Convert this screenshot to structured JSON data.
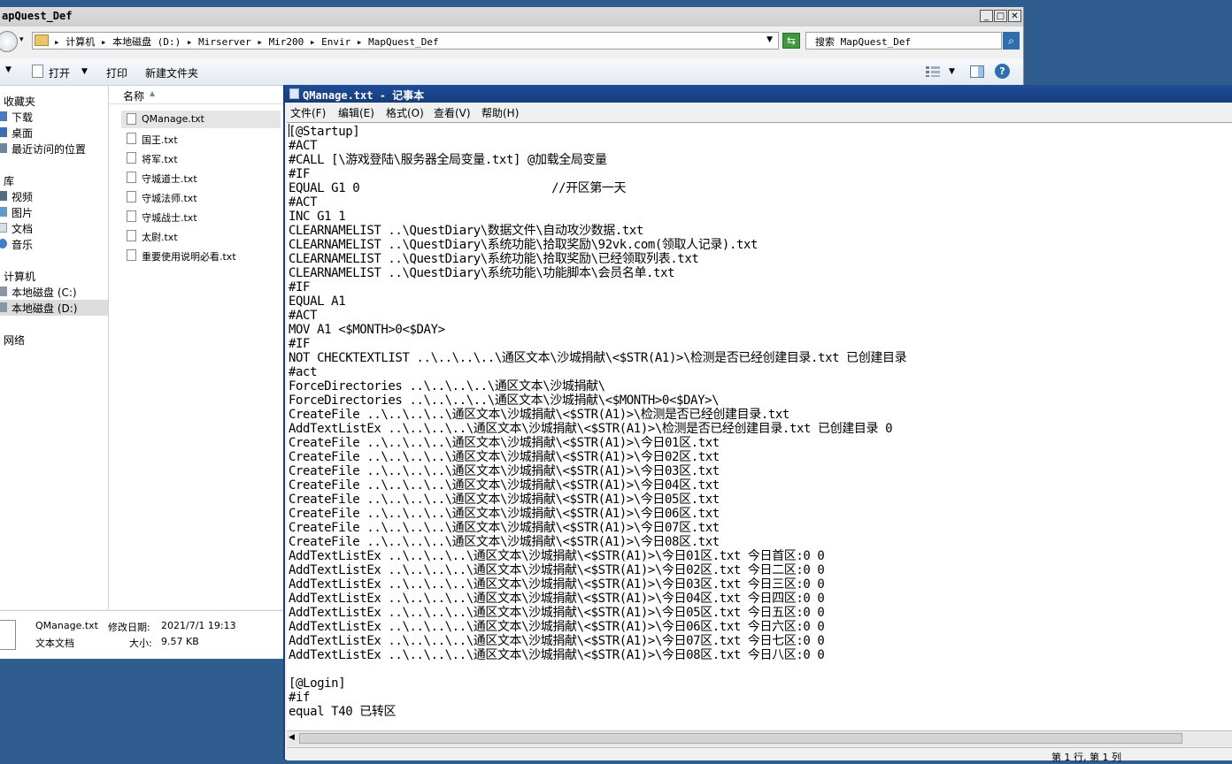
{
  "explorer": {
    "title": "apQuest_Def",
    "breadcrumbs": "▸ 计算机 ▸ 本地磁盘 (D:) ▸ Mirserver ▸ Mir200 ▸ Envir ▸ MapQuest_Def",
    "search_placeholder": "搜索 MapQuest_Def",
    "toolbar": {
      "open": "打开",
      "print": "打印",
      "new_folder": "新建文件夹"
    },
    "nav": {
      "favorites": "收藏夹",
      "downloads": "下载",
      "desktop": "桌面",
      "recent": "最近访问的位置",
      "libraries": "库",
      "videos": "视频",
      "pictures": "图片",
      "documents": "文档",
      "music": "音乐",
      "computer": "计算机",
      "drive_c": "本地磁盘 (C:)",
      "drive_d": "本地磁盘 (D:)",
      "network": "网络"
    },
    "column_name": "名称",
    "files": [
      "QManage.txt",
      "国王.txt",
      "将军.txt",
      "守城道士.txt",
      "守城法师.txt",
      "守城战士.txt",
      "太尉.txt",
      "重要使用说明必看.txt"
    ],
    "details": {
      "filename": "QManage.txt",
      "modified_label": "修改日期:",
      "modified_value": "2021/7/1 19:13",
      "type": "文本文档",
      "size_label": "大小:",
      "size_value": "9.57 KB"
    }
  },
  "notepad": {
    "title": "QManage.txt - 记事本",
    "menu": [
      "文件(F)",
      "编辑(E)",
      "格式(O)",
      "查看(V)",
      "帮助(H)"
    ],
    "lines": [
      "[@Startup]",
      "#ACT",
      "#CALL [\\游戏登陆\\服务器全局变量.txt] @加载全局变量",
      "#IF",
      "EQUAL G1 0                           //开区第一天",
      "#ACT",
      "INC G1 1",
      "CLEARNAMELIST ..\\QuestDiary\\数据文件\\自动攻沙数据.txt",
      "CLEARNAMELIST ..\\QuestDiary\\系统功能\\拾取奖励\\92vk.com(领取人记录).txt",
      "CLEARNAMELIST ..\\QuestDiary\\系统功能\\拾取奖励\\已经领取列表.txt",
      "CLEARNAMELIST ..\\QuestDiary\\系统功能\\功能脚本\\会员名单.txt",
      "#IF",
      "EQUAL A1",
      "#ACT",
      "MOV A1 <$MONTH>0<$DAY>",
      "#IF",
      "NOT CHECKTEXTLIST ..\\..\\..\\..\\通区文本\\沙城捐献\\<$STR(A1)>\\检测是否已经创建目录.txt 已创建目录",
      "#act",
      "ForceDirectories ..\\..\\..\\..\\通区文本\\沙城捐献\\",
      "ForceDirectories ..\\..\\..\\..\\通区文本\\沙城捐献\\<$MONTH>0<$DAY>\\",
      "CreateFile ..\\..\\..\\..\\通区文本\\沙城捐献\\<$STR(A1)>\\检测是否已经创建目录.txt",
      "AddTextListEx ..\\..\\..\\..\\通区文本\\沙城捐献\\<$STR(A1)>\\检测是否已经创建目录.txt 已创建目录 0",
      "CreateFile ..\\..\\..\\..\\通区文本\\沙城捐献\\<$STR(A1)>\\今日01区.txt",
      "CreateFile ..\\..\\..\\..\\通区文本\\沙城捐献\\<$STR(A1)>\\今日02区.txt",
      "CreateFile ..\\..\\..\\..\\通区文本\\沙城捐献\\<$STR(A1)>\\今日03区.txt",
      "CreateFile ..\\..\\..\\..\\通区文本\\沙城捐献\\<$STR(A1)>\\今日04区.txt",
      "CreateFile ..\\..\\..\\..\\通区文本\\沙城捐献\\<$STR(A1)>\\今日05区.txt",
      "CreateFile ..\\..\\..\\..\\通区文本\\沙城捐献\\<$STR(A1)>\\今日06区.txt",
      "CreateFile ..\\..\\..\\..\\通区文本\\沙城捐献\\<$STR(A1)>\\今日07区.txt",
      "CreateFile ..\\..\\..\\..\\通区文本\\沙城捐献\\<$STR(A1)>\\今日08区.txt",
      "AddTextListEx ..\\..\\..\\..\\通区文本\\沙城捐献\\<$STR(A1)>\\今日01区.txt 今日首区:0 0",
      "AddTextListEx ..\\..\\..\\..\\通区文本\\沙城捐献\\<$STR(A1)>\\今日02区.txt 今日二区:0 0",
      "AddTextListEx ..\\..\\..\\..\\通区文本\\沙城捐献\\<$STR(A1)>\\今日03区.txt 今日三区:0 0",
      "AddTextListEx ..\\..\\..\\..\\通区文本\\沙城捐献\\<$STR(A1)>\\今日04区.txt 今日四区:0 0",
      "AddTextListEx ..\\..\\..\\..\\通区文本\\沙城捐献\\<$STR(A1)>\\今日05区.txt 今日五区:0 0",
      "AddTextListEx ..\\..\\..\\..\\通区文本\\沙城捐献\\<$STR(A1)>\\今日06区.txt 今日六区:0 0",
      "AddTextListEx ..\\..\\..\\..\\通区文本\\沙城捐献\\<$STR(A1)>\\今日07区.txt 今日七区:0 0",
      "AddTextListEx ..\\..\\..\\..\\通区文本\\沙城捐献\\<$STR(A1)>\\今日08区.txt 今日八区:0 0",
      "",
      "[@Login]",
      "#if",
      "equal T40 已转区"
    ],
    "status": "第 1 行, 第 1 列"
  }
}
